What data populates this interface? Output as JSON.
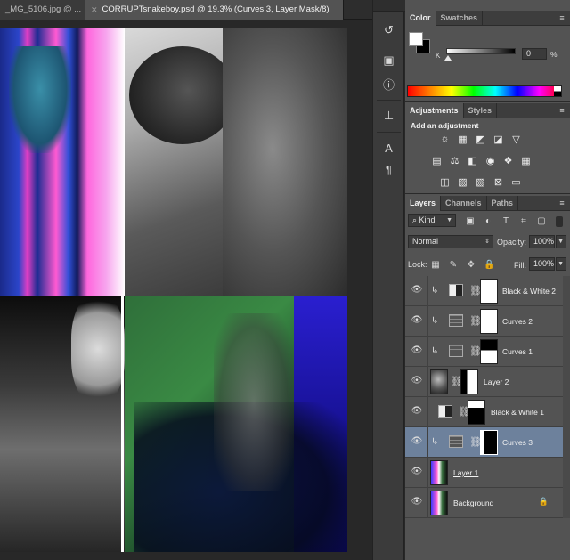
{
  "doc_tabs": [
    {
      "label": "_MG_5106.jpg @ ...",
      "active": false
    },
    {
      "label": "CORRUPTsnakeboy.psd @ 19.3% (Curves 3, Layer Mask/8)",
      "active": true
    }
  ],
  "color_panel": {
    "tabs": [
      "Color",
      "Swatches"
    ],
    "channel_label": "K",
    "channel_value": "0",
    "channel_unit": "%"
  },
  "adjust_panel": {
    "tabs": [
      "Adjustments",
      "Styles"
    ],
    "title": "Add an adjustment"
  },
  "layers_panel": {
    "tabs": [
      "Layers",
      "Channels",
      "Paths"
    ],
    "filter_kind": "Kind",
    "blend_mode": "Normal",
    "opacity_label": "Opacity:",
    "opacity_value": "100%",
    "lock_label": "Lock:",
    "fill_label": "Fill:",
    "fill_value": "100%",
    "layers": [
      {
        "name": "Black & White 2",
        "kind": "bw",
        "clipped": true,
        "selected": false
      },
      {
        "name": "Curves 2",
        "kind": "curves",
        "clipped": true,
        "selected": false
      },
      {
        "name": "Curves 1",
        "kind": "curves",
        "clipped": true,
        "selected": false
      },
      {
        "name": "Layer 2",
        "kind": "pixel",
        "clipped": false,
        "selected": false
      },
      {
        "name": "Black & White 1",
        "kind": "bw",
        "clipped": false,
        "selected": false
      },
      {
        "name": "Curves 3",
        "kind": "curves",
        "clipped": true,
        "selected": true
      },
      {
        "name": "Layer 1",
        "kind": "pixel",
        "clipped": false,
        "selected": false
      },
      {
        "name": "Background",
        "kind": "background",
        "clipped": false,
        "selected": false
      }
    ]
  }
}
